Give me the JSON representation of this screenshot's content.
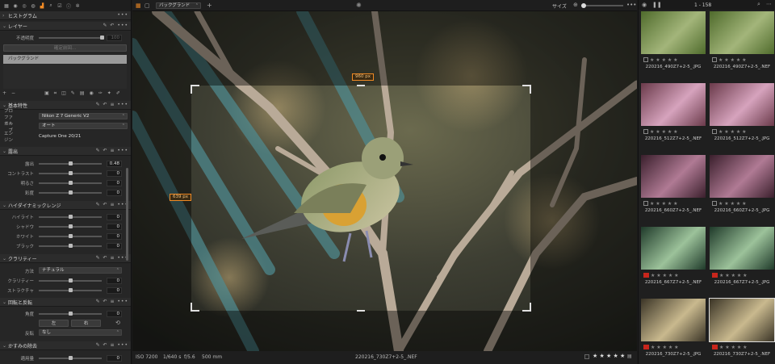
{
  "left": {
    "histogram": "ヒストグラム",
    "layers": {
      "title": "レイヤー",
      "opacity_label": "不透明度",
      "opacity_value": "100",
      "fill_mask_btn": "確定前回...",
      "layer_name": "バックグランド"
    },
    "basic": {
      "title": "基本特性",
      "profile_label": "プロファイル",
      "profile_value": "Nikon Z 7 Generic V2",
      "curve_label": "カーブ",
      "curve_value": "オート",
      "engine_label": "エンジン",
      "engine_value": "Capture One 20/21"
    },
    "exposure": {
      "title": "露出",
      "rows": [
        {
          "label": "露出",
          "value": "0.48",
          "pos": 0.5
        },
        {
          "label": "コントラスト",
          "value": "0",
          "pos": 0.5
        },
        {
          "label": "明るさ",
          "value": "0",
          "pos": 0.5
        },
        {
          "label": "彩度",
          "value": "0",
          "pos": 0.5
        }
      ]
    },
    "hdr": {
      "title": "ハイダイナミックレンジ",
      "rows": [
        {
          "label": "ハイライト",
          "value": "0",
          "pos": 0.5
        },
        {
          "label": "シャドウ",
          "value": "0",
          "pos": 0.5
        },
        {
          "label": "ホワイト",
          "value": "0",
          "pos": 0.5
        },
        {
          "label": "ブラック",
          "value": "0",
          "pos": 0.5
        }
      ]
    },
    "clarity": {
      "title": "クラリティー",
      "method_label": "方法",
      "method_value": "ナチュラル",
      "rows": [
        {
          "label": "クラリティー",
          "value": "0",
          "pos": 0.5
        },
        {
          "label": "ストラクチャ",
          "value": "0",
          "pos": 0.5
        }
      ]
    },
    "rotation": {
      "title": "回転と反転",
      "angle_label": "角度",
      "angle_value": "0",
      "left_btn": "左",
      "right_btn": "右",
      "flip_label": "反転",
      "flip_value": "なし"
    },
    "dehaze": {
      "title": "かすみの除去",
      "amount_label": "適用量",
      "amount_value": "0"
    }
  },
  "topbar": {
    "layer_select": "バックグランド",
    "size_label": "サイズ"
  },
  "viewer": {
    "crop_width": "960 px",
    "crop_height": "639 px"
  },
  "status": {
    "iso": "ISO 7200",
    "shutter": "1/640 s",
    "aperture": "f/5.6",
    "focal": "500 mm",
    "filename": "220216_730Z7+2-5_.NEF",
    "stars": "★ ★ ★ ★ ★"
  },
  "browser": {
    "count": "1 - 158",
    "items": [
      {
        "name": "220216_490Z7+2-5_.JPG",
        "label": "none",
        "selected": false
      },
      {
        "name": "220216_490Z7+2-5_.NEF",
        "label": "none",
        "selected": false
      },
      {
        "name": "220216_512Z7+2-5_.NEF",
        "label": "none",
        "selected": false
      },
      {
        "name": "220216_512Z7+2-5_.JPG",
        "label": "none",
        "selected": false
      },
      {
        "name": "220216_660Z7+2-5_.NEF",
        "label": "none",
        "selected": false
      },
      {
        "name": "220216_660Z7+2-5_.JPG",
        "label": "none",
        "selected": false
      },
      {
        "name": "220216_667Z7+2-5_.NEF",
        "label": "red",
        "selected": false
      },
      {
        "name": "220216_667Z7+2-5_.JPG",
        "label": "red",
        "selected": false
      },
      {
        "name": "220216_730Z7+2-5_.JPG",
        "label": "red",
        "selected": false
      },
      {
        "name": "220216_730Z7+2-5_.NEF",
        "label": "red",
        "selected": true
      }
    ],
    "stars": "★ ★ ★ ★ ★"
  },
  "colors": {
    "accent": "#f08a24",
    "panel": "#262626",
    "label_red": "#c8261c"
  }
}
